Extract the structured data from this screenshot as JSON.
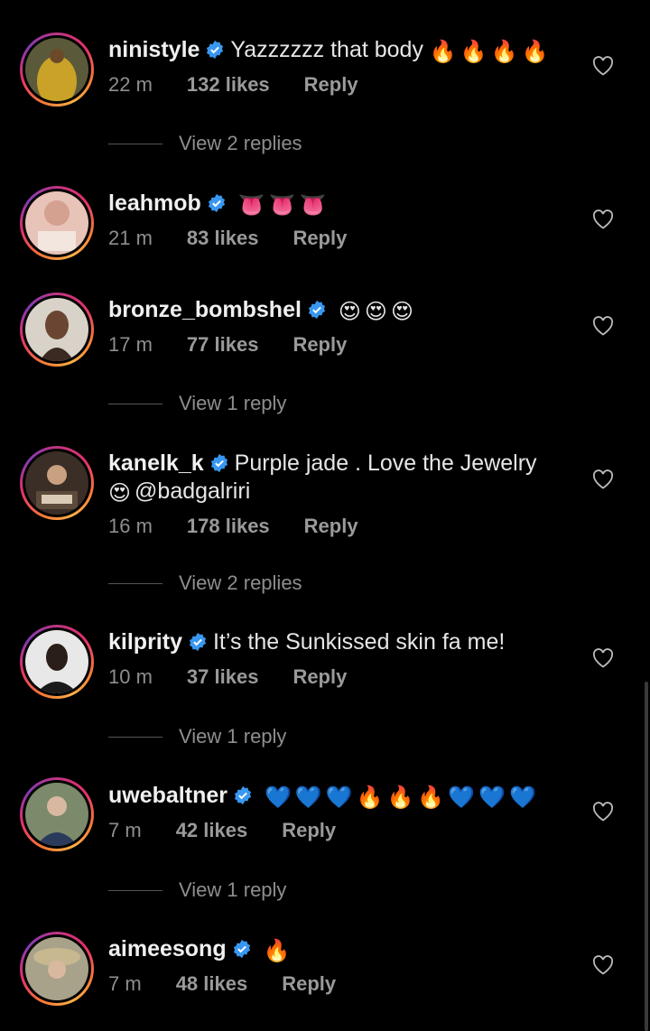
{
  "comments": [
    {
      "username": "ninistyle",
      "text_before": "Yazzzzzz that body",
      "emojis": [
        "🔥",
        "🔥",
        "🔥",
        "🔥"
      ],
      "time": "22 m",
      "likes": "132 likes",
      "reply": "Reply",
      "view_replies": "View 2 replies"
    },
    {
      "username": "leahmob",
      "text_before": "",
      "emojis": [
        "👅",
        "👅",
        "👅"
      ],
      "time": "21 m",
      "likes": "83 likes",
      "reply": "Reply",
      "view_replies": ""
    },
    {
      "username": "bronze_bombshel",
      "text_before": "",
      "emojis": [
        "😍",
        "😍",
        "😍"
      ],
      "time": "17 m",
      "likes": "77 likes",
      "reply": "Reply",
      "view_replies": "View 1 reply"
    },
    {
      "username": "kanelk_k",
      "text_before": "Purple jade . Love the Jewelry",
      "emojis": [
        "😍"
      ],
      "text_after": "@badgalriri",
      "time": "16 m",
      "likes": "178 likes",
      "reply": "Reply",
      "view_replies": "View 2 replies"
    },
    {
      "username": "kilprity",
      "text_before": "It’s the Sunkissed skin fa me!",
      "emojis": [],
      "time": "10 m",
      "likes": "37 likes",
      "reply": "Reply",
      "view_replies": "View 1 reply"
    },
    {
      "username": "uwebaltner",
      "text_before": "",
      "emojis": [
        "💙",
        "💙",
        "💙",
        "🔥",
        "🔥",
        "🔥",
        "💙",
        "💙",
        "💙"
      ],
      "time": "7 m",
      "likes": "42 likes",
      "reply": "Reply",
      "view_replies": "View 1 reply"
    },
    {
      "username": "aimeesong",
      "text_before": "",
      "emojis": [
        "🔥"
      ],
      "time": "7 m",
      "likes": "48 likes",
      "reply": "Reply",
      "view_replies": ""
    }
  ],
  "icons": {
    "verified": "verified-badge-icon",
    "like": "heart-outline-icon"
  },
  "colors": {
    "background": "#000000",
    "verified": "#3897f0",
    "meta": "#8e8e8e"
  }
}
